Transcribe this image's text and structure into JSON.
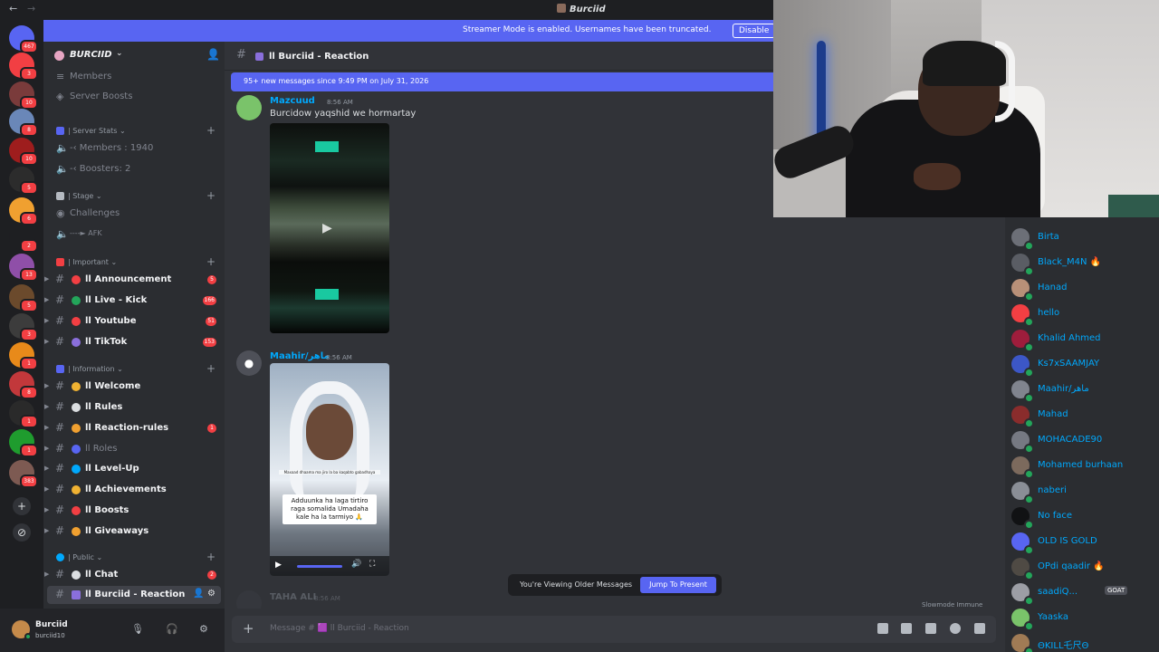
{
  "window": {
    "title": "Burciid",
    "back": "←",
    "forward": "→"
  },
  "banner": {
    "text": "Streamer Mode is enabled. Usernames have been truncated.",
    "disable_label": "Disable"
  },
  "servers": [
    {
      "color": "#5865f2",
      "badge": "467"
    },
    {
      "color": "#f23f43",
      "badge": "3"
    },
    {
      "color": "#7a3b3b",
      "badge": "10"
    },
    {
      "color": "#6a87b8",
      "badge": "8"
    },
    {
      "color": "#9e1d1d",
      "badge": "10"
    },
    {
      "color": "#2c2c2c",
      "badge": "5"
    },
    {
      "color": "#f0a030",
      "badge": "6"
    },
    {
      "color": "#1e1f22",
      "badge": "2"
    },
    {
      "color": "#8f4fa8",
      "badge": "13"
    },
    {
      "color": "#6b4a2c",
      "badge": "5"
    },
    {
      "color": "#3c3c3c",
      "badge": "3"
    },
    {
      "color": "#e88a1a",
      "badge": "1"
    },
    {
      "color": "#c2383b",
      "badge": "8"
    },
    {
      "color": "#2a2a2a",
      "badge": "1"
    },
    {
      "color": "#1f9c2e",
      "badge": "1"
    },
    {
      "color": "#7d5a52",
      "badge": "383"
    }
  ],
  "guild": {
    "name": "BURCIID",
    "chevron": "⌄",
    "invite_icon": "👤"
  },
  "sidebar": {
    "members_label": "Members",
    "boosts_label": "Server Boosts",
    "cat_stats": "| Server Stats ⌄",
    "members_count": "-‹ Members : 1940",
    "boosters_count": "-‹ Boosters: 2",
    "cat_stage": "| Stage ⌄",
    "challenges": "Challenges",
    "afk": "----► AFK",
    "cat_important": "| Important ⌄",
    "cat_information": "| Information ⌄",
    "cat_public": "| Public ⌄",
    "channels": [
      {
        "label": "ll Announcement",
        "count": "5",
        "emo": "#f23f43",
        "unread": true
      },
      {
        "label": "ll Live - Kick",
        "count": "166",
        "emo": "#23a55a",
        "unread": true
      },
      {
        "label": "ll Youtube",
        "count": "51",
        "emo": "#f23f43",
        "unread": true
      },
      {
        "label": "ll TikTok",
        "count": "153",
        "emo": "#8a6fdc",
        "unread": true
      },
      {
        "label": "ll Welcome",
        "count": "",
        "emo": "#f0b232",
        "unread": true
      },
      {
        "label": "ll Rules",
        "count": "",
        "emo": "#dbdee1",
        "unread": true
      },
      {
        "label": "ll Reaction-rules",
        "count": "1",
        "emo": "#f0a030",
        "unread": true
      },
      {
        "label": "ll Roles",
        "count": "",
        "emo": "#5865f2",
        "unread": false
      },
      {
        "label": "ll Level-Up",
        "count": "",
        "emo": "#00a8fc",
        "unread": true
      },
      {
        "label": "ll Achievements",
        "count": "",
        "emo": "#f0b232",
        "unread": true
      },
      {
        "label": "ll Boosts",
        "count": "",
        "emo": "#f23f43",
        "unread": true
      },
      {
        "label": "ll Giveaways",
        "count": "",
        "emo": "#f0a030",
        "unread": true
      },
      {
        "label": "ll Chat",
        "count": "2",
        "emo": "#dbdee1",
        "unread": true
      }
    ],
    "selected_channel": "ll Burciid - Reaction"
  },
  "user": {
    "name": "Burciid",
    "tag": "burciid10"
  },
  "chat": {
    "header": "ll Burciid - Reaction",
    "new_messages": "95+ new messages since 9:49 PM on July 31, 2026",
    "messages": [
      {
        "author": "Mazcuud",
        "time": "8:56 AM",
        "text": "Burcidow yaqshid we hormartay"
      },
      {
        "author": "Maahir/ماهر",
        "time": "8:56 AM"
      },
      {
        "author": "TAHA ALI",
        "time": "8:56 AM"
      }
    ],
    "video_caption_small": "Maxaad dhaama ma jiro la ba kaqabto gabadhaya",
    "video_caption": "Adduunka ha laga tirtiro raga somalida Umadaha kale ha la tarmiyo 🙏",
    "older_text": "You're Viewing Older Messages",
    "jump_label": "Jump To Present",
    "slowmode": "Slowmode Immune",
    "composer_placeholder": "Message # 🟪 ll Burciid - Reaction"
  },
  "member_list": [
    {
      "name": "Birta",
      "color": "#6c6f77",
      "tag": ""
    },
    {
      "name": "Black_M4N 🔥",
      "color": "#5a5d64",
      "tag": ""
    },
    {
      "name": "Hanad",
      "color": "#b89078",
      "tag": ""
    },
    {
      "name": "hello",
      "color": "#f23f43",
      "tag": ""
    },
    {
      "name": "Khalid Ahmed",
      "color": "#9e1d3c",
      "tag": ""
    },
    {
      "name": "Ks7xSAAMJAY",
      "color": "#3c57c7",
      "tag": ""
    },
    {
      "name": "Maahir/ماهر",
      "color": "#80848e",
      "tag": ""
    },
    {
      "name": "Mahad",
      "color": "#8a2c2c",
      "tag": ""
    },
    {
      "name": "MOHACADE90",
      "color": "#767982",
      "tag": ""
    },
    {
      "name": "Mohamed burhaan",
      "color": "#7c6a5d",
      "tag": ""
    },
    {
      "name": "naberi",
      "color": "#8a8e96",
      "tag": ""
    },
    {
      "name": "No face",
      "color": "#111214",
      "tag": ""
    },
    {
      "name": "OLD IS GOLD",
      "color": "#5865f2",
      "tag": ""
    },
    {
      "name": "OPdi qaadir 🔥",
      "color": "#4f4a44",
      "tag": ""
    },
    {
      "name": "saadiQ...",
      "color": "#9c9ea5",
      "tag": "GOAT"
    },
    {
      "name": "Yaaska",
      "color": "#7ac36a",
      "tag": ""
    },
    {
      "name": "ΘKILL乇尺Θ",
      "color": "#a07b55",
      "tag": ""
    }
  ]
}
